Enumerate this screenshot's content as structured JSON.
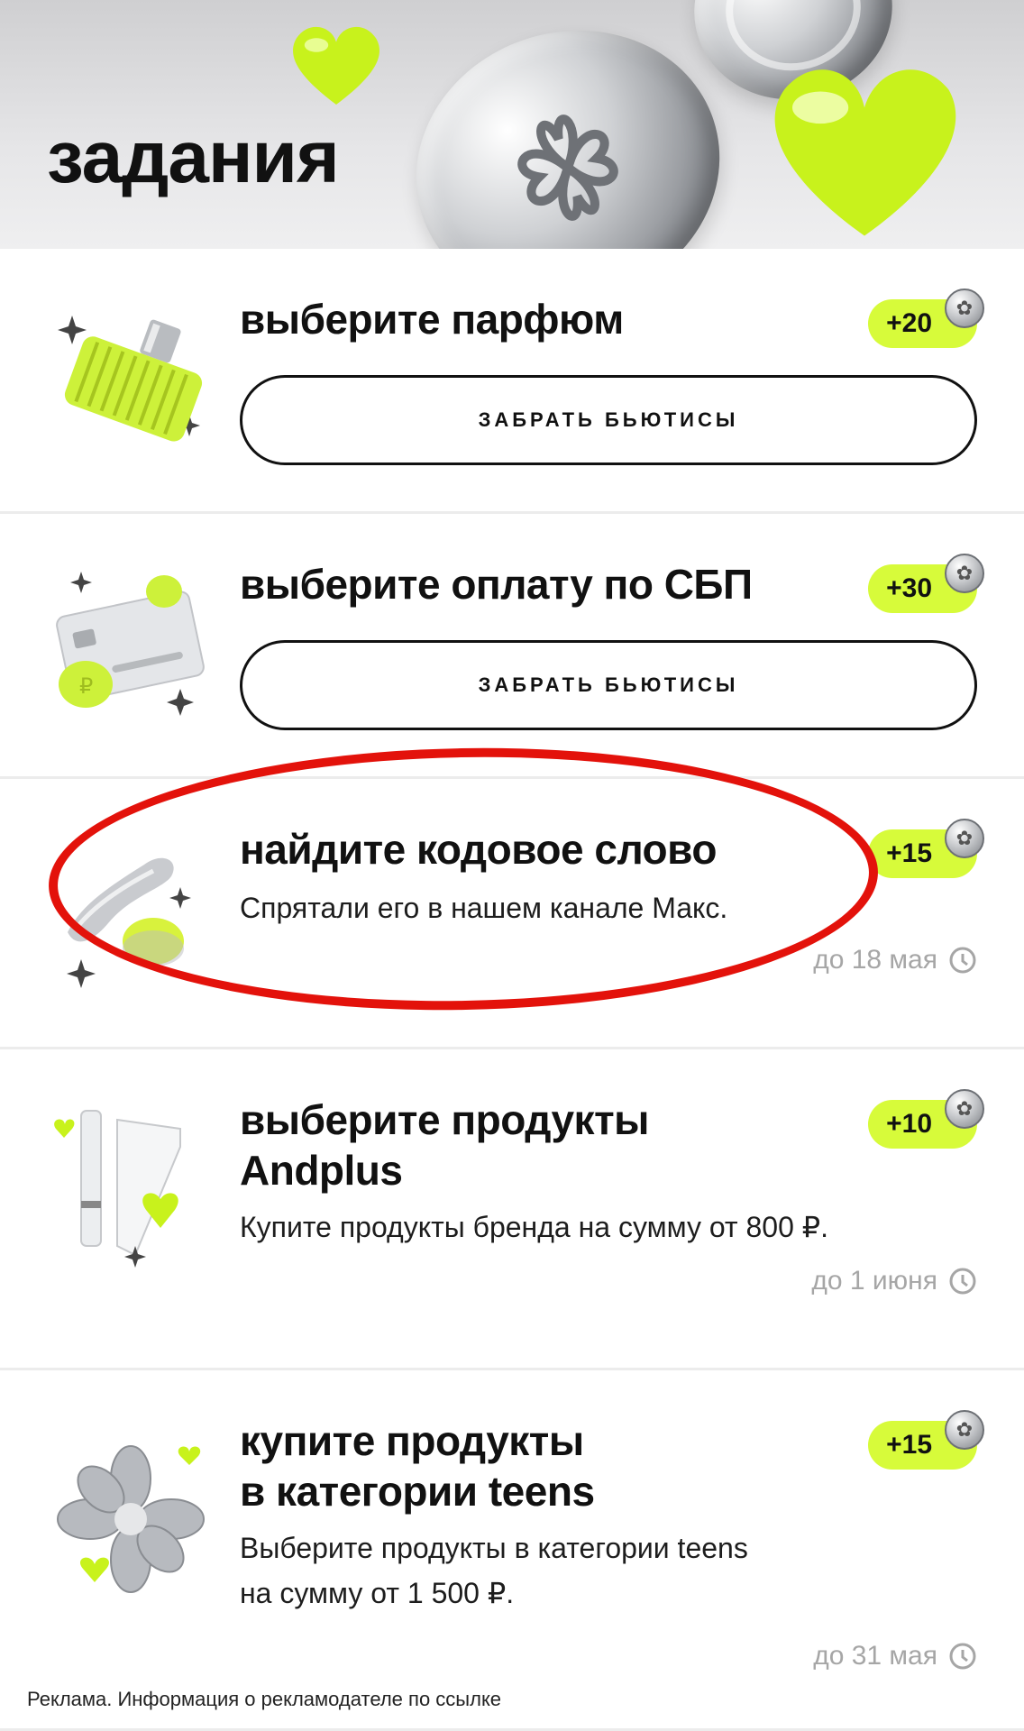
{
  "header": {
    "title": "задания"
  },
  "tasks": [
    {
      "title": "выберите парфюм",
      "reward": "+20",
      "button": "ЗАБРАТЬ БЬЮТИСЫ"
    },
    {
      "title": "выберите оплату по СБП",
      "reward": "+30",
      "button": "ЗАБРАТЬ БЬЮТИСЫ"
    },
    {
      "title": "найдите кодовое слово",
      "reward": "+15",
      "description": "Спрятали его в нашем канале Макс.",
      "deadline": "до 18 мая"
    },
    {
      "title_line1": "выберите продукты",
      "title_line2": "Andplus",
      "reward": "+10",
      "description": "Купите продукты бренда на сумму от 800 ₽.",
      "deadline": "до 1 июня"
    },
    {
      "title_line1": "купите продукты",
      "title_line2": "в категории teens",
      "reward": "+15",
      "description_line1": "Выберите продукты в категории teens",
      "description_line2": "на сумму от 1 500 ₽.",
      "deadline": "до 31 мая"
    }
  ],
  "footer": {
    "ad_text": "Реклама. Информация о рекламодателе по ссылке"
  },
  "colors": {
    "accent": "#d7fb3a",
    "highlight_ring": "#e3120b"
  },
  "icons": [
    "coin-icon",
    "heart-icon",
    "clock-icon",
    "perfume-icon",
    "card-icon",
    "spatula-icon",
    "tube-icon",
    "flower-icon"
  ]
}
